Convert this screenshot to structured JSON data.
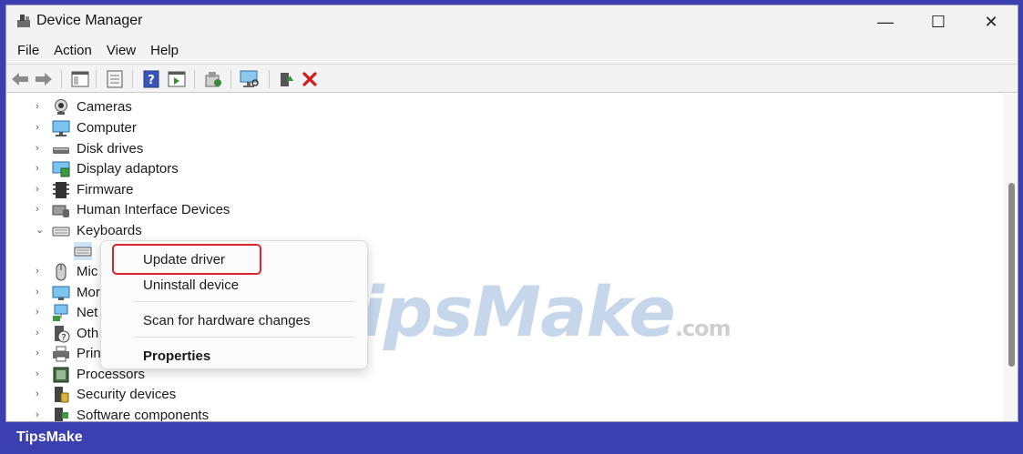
{
  "window": {
    "title": "Device Manager",
    "minimize_glyph": "—",
    "maximize_glyph": "☐",
    "close_glyph": "✕"
  },
  "menu": [
    {
      "label": "File"
    },
    {
      "label": "Action"
    },
    {
      "label": "View"
    },
    {
      "label": "Help"
    }
  ],
  "toolbar": [
    {
      "icon": "back-arrow-icon"
    },
    {
      "icon": "forward-arrow-icon"
    },
    {
      "icon": "show-hide-console-tree-icon"
    },
    {
      "icon": "properties-icon"
    },
    {
      "icon": "help-icon"
    },
    {
      "icon": "action-pane-icon"
    },
    {
      "icon": "update-driver-icon"
    },
    {
      "icon": "scan-hardware-icon"
    },
    {
      "icon": "enable-device-icon"
    },
    {
      "icon": "uninstall-device-icon"
    }
  ],
  "tree": {
    "items": [
      {
        "label": "Cameras",
        "icon": "camera-icon",
        "expanded": false
      },
      {
        "label": "Computer",
        "icon": "computer-icon",
        "expanded": false
      },
      {
        "label": "Disk drives",
        "icon": "disk-drive-icon",
        "expanded": false
      },
      {
        "label": "Display adaptors",
        "icon": "display-adapter-icon",
        "expanded": false
      },
      {
        "label": "Firmware",
        "icon": "firmware-icon",
        "expanded": false
      },
      {
        "label": "Human Interface Devices",
        "icon": "hid-icon",
        "expanded": false
      },
      {
        "label": "Keyboards",
        "icon": "keyboard-icon",
        "expanded": true
      },
      {
        "label": "",
        "icon": "keyboard-device-icon",
        "expanded": false
      },
      {
        "label": "Mic",
        "icon": "mouse-icon",
        "expanded": false
      },
      {
        "label": "Mor",
        "icon": "monitor-icon",
        "expanded": false
      },
      {
        "label": "Net",
        "icon": "network-icon",
        "expanded": false
      },
      {
        "label": "Oth",
        "icon": "other-devices-icon",
        "expanded": false
      },
      {
        "label": "Prin",
        "icon": "printer-icon",
        "expanded": false
      },
      {
        "label": "Processors",
        "icon": "processor-icon",
        "expanded": false
      },
      {
        "label": "Security devices",
        "icon": "security-device-icon",
        "expanded": false
      },
      {
        "label": "Software components",
        "icon": "software-component-icon",
        "expanded": false
      }
    ]
  },
  "context_menu": {
    "update_driver": "Update driver",
    "uninstall_device": "Uninstall device",
    "scan_hardware": "Scan for hardware changes",
    "properties": "Properties"
  },
  "watermark": {
    "main": "TipsMake",
    "suffix": ".com"
  },
  "footer": {
    "brand": "TipsMake"
  },
  "colors": {
    "highlight": "#d9262b",
    "footer_bg": "#3c3fb0"
  }
}
